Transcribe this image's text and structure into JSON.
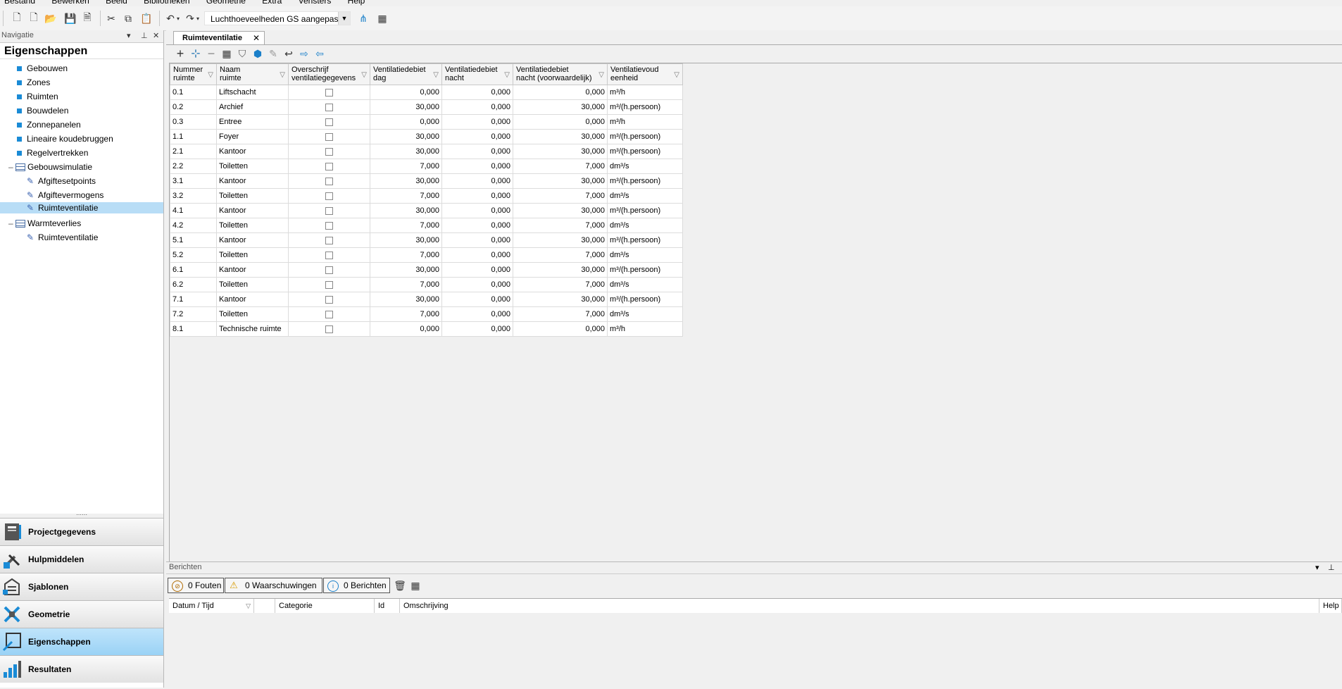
{
  "menu": [
    "Bestand",
    "Bewerken",
    "Beeld",
    "Bibliotheken",
    "Geometrie",
    "Extra",
    "Vensters",
    "Help"
  ],
  "toolbar": {
    "profile_value": "Luchthoeveelheden GS aangepast"
  },
  "navigation": {
    "panel_title": "Navigatie",
    "section_title": "Eigenschappen",
    "items": [
      {
        "label": "Gebouwen"
      },
      {
        "label": "Zones"
      },
      {
        "label": "Ruimten"
      },
      {
        "label": "Bouwdelen"
      },
      {
        "label": "Zonnepanelen"
      },
      {
        "label": "Lineaire koudebruggen"
      },
      {
        "label": "Regelvertrekken"
      },
      {
        "label": "Gebouwsimulatie"
      },
      {
        "label": "Afgiftesetpoints"
      },
      {
        "label": "Afgiftevermogens"
      },
      {
        "label": "Ruimteventilatie"
      },
      {
        "label": "Warmteverlies"
      },
      {
        "label": "Ruimteventilatie"
      }
    ],
    "buttons": [
      {
        "label": "Projectgegevens"
      },
      {
        "label": "Hulpmiddelen"
      },
      {
        "label": "Sjablonen"
      },
      {
        "label": "Geometrie"
      },
      {
        "label": "Eigenschappen"
      },
      {
        "label": "Resultaten"
      }
    ]
  },
  "document": {
    "tab_label": "Ruimteventilatie",
    "columns": [
      [
        "Nummer",
        "ruimte"
      ],
      [
        "Naam",
        "ruimte"
      ],
      [
        "Overschrijf",
        "ventilatiegegevens"
      ],
      [
        "Ventilatiedebiet",
        "dag"
      ],
      [
        "Ventilatiedebiet",
        "nacht"
      ],
      [
        "Ventilatiedebiet",
        "nacht (voorwaardelijk)"
      ],
      [
        "Ventilatievoud",
        "eenheid"
      ]
    ],
    "rows": [
      [
        "0.1",
        "Liftschacht",
        "0,000",
        "0,000",
        "0,000",
        "m³/h"
      ],
      [
        "0.2",
        "Archief",
        "30,000",
        "0,000",
        "30,000",
        "m³/(h.persoon)"
      ],
      [
        "0.3",
        "Entree",
        "0,000",
        "0,000",
        "0,000",
        "m³/h"
      ],
      [
        "1.1",
        "Foyer",
        "30,000",
        "0,000",
        "30,000",
        "m³/(h.persoon)"
      ],
      [
        "2.1",
        "Kantoor",
        "30,000",
        "0,000",
        "30,000",
        "m³/(h.persoon)"
      ],
      [
        "2.2",
        "Toiletten",
        "7,000",
        "0,000",
        "7,000",
        "dm³/s"
      ],
      [
        "3.1",
        "Kantoor",
        "30,000",
        "0,000",
        "30,000",
        "m³/(h.persoon)"
      ],
      [
        "3.2",
        "Toiletten",
        "7,000",
        "0,000",
        "7,000",
        "dm³/s"
      ],
      [
        "4.1",
        "Kantoor",
        "30,000",
        "0,000",
        "30,000",
        "m³/(h.persoon)"
      ],
      [
        "4.2",
        "Toiletten",
        "7,000",
        "0,000",
        "7,000",
        "dm³/s"
      ],
      [
        "5.1",
        "Kantoor",
        "30,000",
        "0,000",
        "30,000",
        "m³/(h.persoon)"
      ],
      [
        "5.2",
        "Toiletten",
        "7,000",
        "0,000",
        "7,000",
        "dm³/s"
      ],
      [
        "6.1",
        "Kantoor",
        "30,000",
        "0,000",
        "30,000",
        "m³/(h.persoon)"
      ],
      [
        "6.2",
        "Toiletten",
        "7,000",
        "0,000",
        "7,000",
        "dm³/s"
      ],
      [
        "7.1",
        "Kantoor",
        "30,000",
        "0,000",
        "30,000",
        "m³/(h.persoon)"
      ],
      [
        "7.2",
        "Toiletten",
        "7,000",
        "0,000",
        "7,000",
        "dm³/s"
      ],
      [
        "8.1",
        "Technische ruimte",
        "0,000",
        "0,000",
        "0,000",
        "m³/h"
      ]
    ]
  },
  "messages": {
    "panel_title": "Berichten",
    "errors_label": "0 Fouten",
    "warnings_label": "0 Waarschuwingen",
    "messages_label": "0 Berichten",
    "columns": [
      "Datum / Tijd",
      "",
      "Categorie",
      "Id",
      "Omschrijving",
      "Help"
    ]
  },
  "colors": {
    "accent": "#1a8bd6",
    "selection": "#b8ddf6"
  }
}
